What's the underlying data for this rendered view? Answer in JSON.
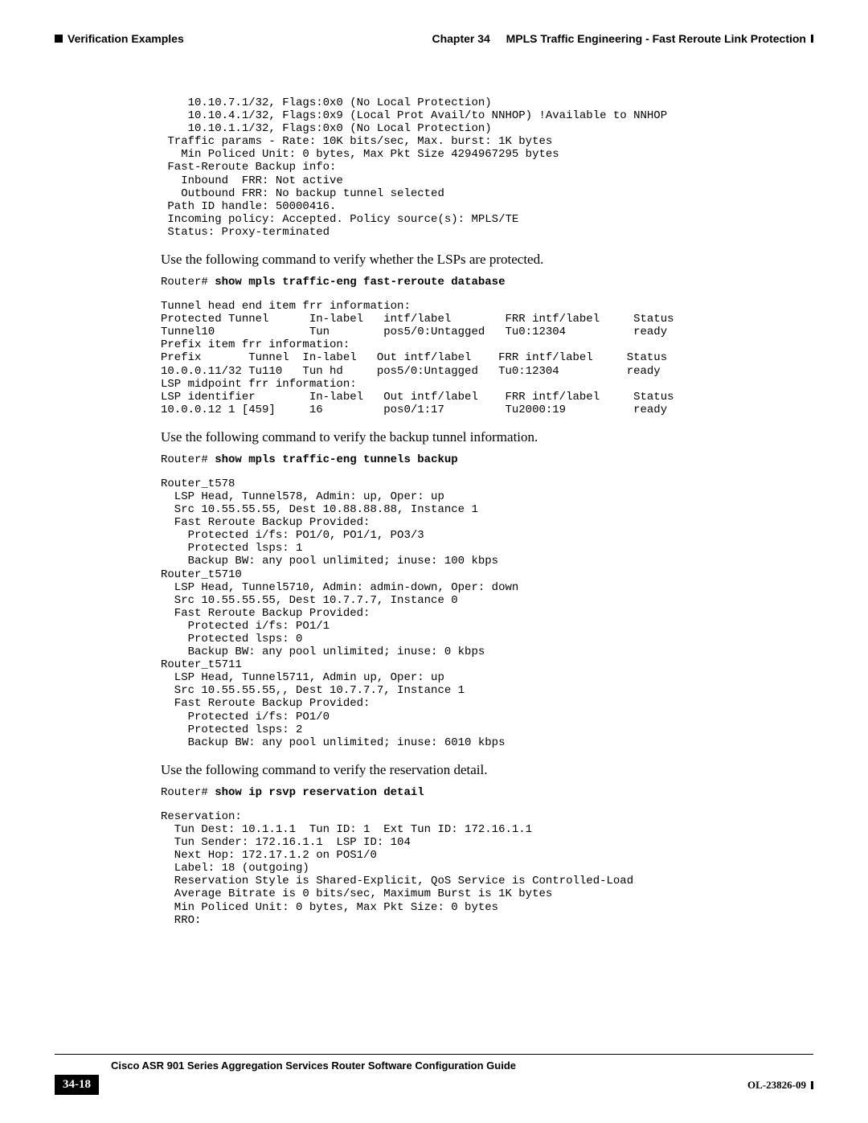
{
  "header": {
    "chapter": "Chapter 34",
    "title": "MPLS Traffic Engineering - Fast Reroute Link Protection",
    "section": "Verification Examples"
  },
  "block1": "    10.10.7.1/32, Flags:0x0 (No Local Protection)\n    10.10.4.1/32, Flags:0x9 (Local Prot Avail/to NNHOP) !Available to NNHOP\n    10.10.1.1/32, Flags:0x0 (No Local Protection)\n Traffic params - Rate: 10K bits/sec, Max. burst: 1K bytes\n   Min Policed Unit: 0 bytes, Max Pkt Size 4294967295 bytes\n Fast-Reroute Backup info:\n   Inbound  FRR: Not active\n   Outbound FRR: No backup tunnel selected\n Path ID handle: 50000416.\n Incoming policy: Accepted. Policy source(s): MPLS/TE\n Status: Proxy-terminated",
  "para1": "Use the following command to verify whether the LSPs are protected.",
  "cmd1_prompt": "Router# ",
  "cmd1_cmd": "show mpls traffic-eng fast-reroute database",
  "block2": "Tunnel head end item frr information:\nProtected Tunnel      In-label   intf/label        FRR intf/label     Status\nTunnel10              Tun        pos5/0:Untagged   Tu0:12304          ready\nPrefix item frr information:\nPrefix       Tunnel  In-label   Out intf/label    FRR intf/label     Status\n10.0.0.11/32 Tu110   Tun hd     pos5/0:Untagged   Tu0:12304          ready\nLSP midpoint frr information:\nLSP identifier        In-label   Out intf/label    FRR intf/label     Status\n10.0.0.12 1 [459]     16         pos0/1:17         Tu2000:19          ready",
  "para2": "Use the following command to verify the backup tunnel information.",
  "cmd2_prompt": "Router# ",
  "cmd2_cmd": "show mpls traffic-eng tunnels backup",
  "block3": "Router_t578\n  LSP Head, Tunnel578, Admin: up, Oper: up\n  Src 10.55.55.55, Dest 10.88.88.88, Instance 1\n  Fast Reroute Backup Provided:\n    Protected i/fs: PO1/0, PO1/1, PO3/3\n    Protected lsps: 1\n    Backup BW: any pool unlimited; inuse: 100 kbps\nRouter_t5710\n  LSP Head, Tunnel5710, Admin: admin-down, Oper: down\n  Src 10.55.55.55, Dest 10.7.7.7, Instance 0\n  Fast Reroute Backup Provided:\n    Protected i/fs: PO1/1\n    Protected lsps: 0\n    Backup BW: any pool unlimited; inuse: 0 kbps\nRouter_t5711\n  LSP Head, Tunnel5711, Admin up, Oper: up\n  Src 10.55.55.55,, Dest 10.7.7.7, Instance 1\n  Fast Reroute Backup Provided:\n    Protected i/fs: PO1/0\n    Protected lsps: 2\n    Backup BW: any pool unlimited; inuse: 6010 kbps",
  "para3": "Use the following command to verify the reservation detail.",
  "cmd3_prompt": "Router# ",
  "cmd3_cmd": "show ip rsvp reservation detail",
  "block4": "Reservation:\n  Tun Dest: 10.1.1.1  Tun ID: 1  Ext Tun ID: 172.16.1.1\n  Tun Sender: 172.16.1.1  LSP ID: 104\n  Next Hop: 172.17.1.2 on POS1/0\n  Label: 18 (outgoing)\n  Reservation Style is Shared-Explicit, QoS Service is Controlled-Load\n  Average Bitrate is 0 bits/sec, Maximum Burst is 1K bytes\n  Min Policed Unit: 0 bytes, Max Pkt Size: 0 bytes\n  RRO:",
  "footer": {
    "guide_title": "Cisco ASR 901 Series Aggregation Services Router Software Configuration Guide",
    "page_number": "34-18",
    "doc_id": "OL-23826-09"
  }
}
